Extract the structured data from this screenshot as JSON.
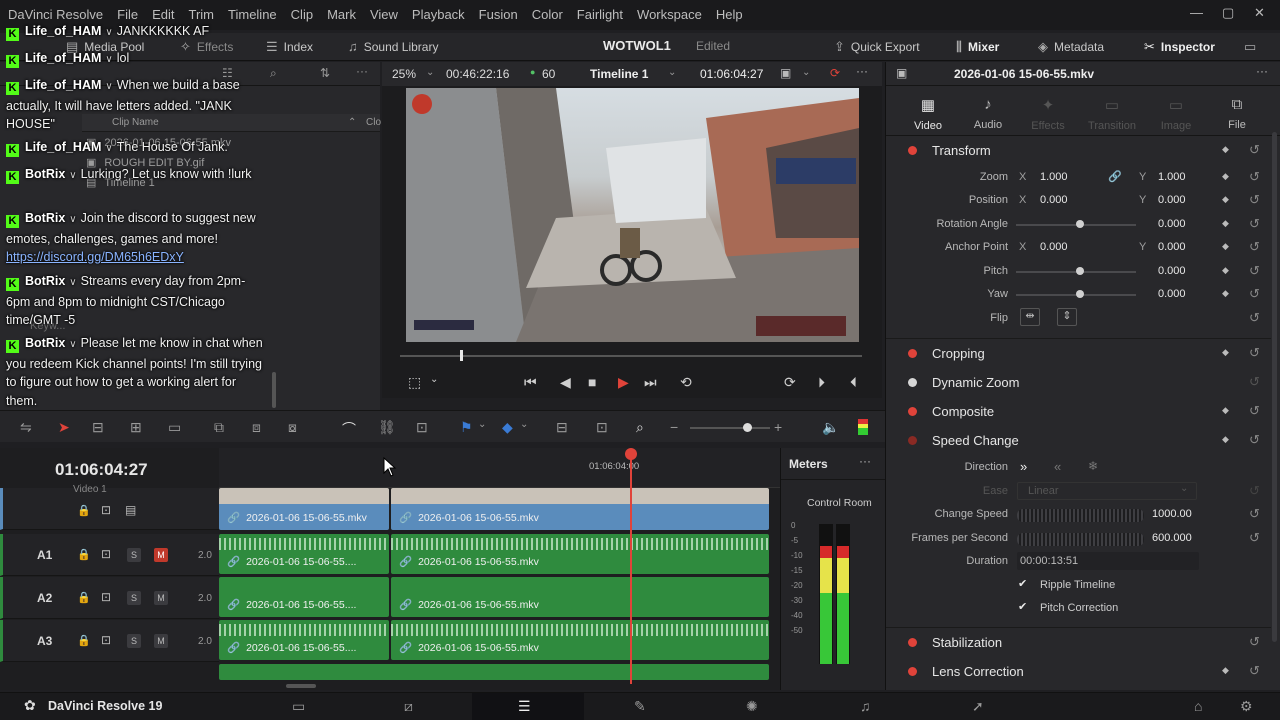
{
  "menubar": [
    "DaVinci Resolve",
    "File",
    "Edit",
    "Trim",
    "Timeline",
    "Clip",
    "Mark",
    "View",
    "Playback",
    "Fusion",
    "Color",
    "Fairlight",
    "Workspace",
    "Help"
  ],
  "toolbar": {
    "media_pool": "Media Pool",
    "effects": "Effects",
    "index": "Index",
    "sound_library": "Sound Library",
    "project_title": "WOTWOL1",
    "project_status": "Edited",
    "quick_export": "Quick Export",
    "mixer": "Mixer",
    "metadata": "Metadata",
    "inspector": "Inspector"
  },
  "media_pool": {
    "column_clip_name": "Clip Name",
    "column_other": "Clo",
    "rows": [
      "2026-01-06 15-06-55.mkv",
      "ROUGH EDIT BY.gif",
      "Timeline 1"
    ],
    "faded_labels": [
      "Keyw..."
    ]
  },
  "chat": [
    {
      "user": "Life_of_HAM",
      "text": "JANKKKKKK AF"
    },
    {
      "user": "Life_of_HAM",
      "text": "lol"
    },
    {
      "user": "Life_of_HAM",
      "text": "When we build a base actually, It will have letters added. \"JANK HOUSE\""
    },
    {
      "user": "Life_of_HAM",
      "text": "The House Of Jank."
    },
    {
      "user": "BotRix",
      "text": "Lurking? Let us know with !lurk"
    },
    {
      "user": "BotRix",
      "text": "Join the discord to suggest new emotes, challenges, games and more!",
      "link": "https://discord.gg/DM65h6EDxY"
    },
    {
      "user": "BotRix",
      "text": "Streams every day from 2pm-6pm and 8pm to midnight CST/Chicago time/GMT -5"
    },
    {
      "user": "BotRix",
      "text": "Please let me know in chat when you redeem Kick channel points! I'm still trying to figure out how to get a working alert for them."
    }
  ],
  "viewer": {
    "zoom": "25%",
    "source_tc": "00:46:22:16",
    "fps": "60",
    "timeline_name": "Timeline 1",
    "record_tc": "01:06:04:27",
    "clip_name": "2026-01-06 15-06-55.mkv",
    "playhead_fraction": 0.13
  },
  "timeline": {
    "timecode": "01:06:04:27",
    "ruler_mark": "01:06:04:00",
    "video_track": {
      "name": "Video 1",
      "clips": [
        "2026-01-06 15-06-55.mkv",
        "2026-01-06 15-06-55.mkv"
      ]
    },
    "audio_tracks": [
      {
        "name": "A1",
        "vol": "2.0",
        "mute": true,
        "clips": [
          "2026-01-06 15-06-55....",
          "2026-01-06 15-06-55.mkv"
        ]
      },
      {
        "name": "A2",
        "vol": "2.0",
        "mute": false,
        "clips": [
          "2026-01-06 15-06-55....",
          "2026-01-06 15-06-55.mkv"
        ]
      },
      {
        "name": "A3",
        "vol": "2.0",
        "mute": false,
        "clips": [
          "2026-01-06 15-06-55....",
          "2026-01-06 15-06-55.mkv"
        ]
      }
    ],
    "solo_label": "S",
    "mute_label": "M"
  },
  "meters": {
    "title": "Meters",
    "control_room": "Control Room",
    "scale": [
      "0",
      "-5",
      "-10",
      "-15",
      "-20",
      "-30",
      "-40",
      "-50"
    ]
  },
  "inspector": {
    "clip_name": "2026-01-06 15-06-55.mkv",
    "tabs": [
      {
        "label": "Video",
        "icon": "film-icon",
        "state": "active"
      },
      {
        "label": "Audio",
        "icon": "music-note-icon",
        "state": "enabled"
      },
      {
        "label": "Effects",
        "icon": "wand-icon",
        "state": "disabled"
      },
      {
        "label": "Transition",
        "icon": "transition-icon",
        "state": "disabled"
      },
      {
        "label": "Image",
        "icon": "image-icon",
        "state": "disabled"
      },
      {
        "label": "File",
        "icon": "file-icon",
        "state": "enabled"
      }
    ],
    "transform": {
      "title": "Transform",
      "zoom": {
        "label": "Zoom",
        "x": "1.000",
        "y": "1.000"
      },
      "position": {
        "label": "Position",
        "x": "0.000",
        "y": "0.000"
      },
      "rotation": {
        "label": "Rotation Angle",
        "value": "0.000"
      },
      "anchor": {
        "label": "Anchor Point",
        "x": "0.000",
        "y": "0.000"
      },
      "pitch": {
        "label": "Pitch",
        "value": "0.000"
      },
      "yaw": {
        "label": "Yaw",
        "value": "0.000"
      },
      "flip": {
        "label": "Flip"
      }
    },
    "sections": {
      "cropping": "Cropping",
      "dynamic_zoom": "Dynamic Zoom",
      "composite": "Composite",
      "speed_change": "Speed Change",
      "stabilization": "Stabilization",
      "lens_correction": "Lens Correction"
    },
    "speed": {
      "direction_label": "Direction",
      "ease_label": "Ease",
      "ease_value": "Linear",
      "change_speed_label": "Change Speed",
      "change_speed_value": "1000.00",
      "fps_label": "Frames per Second",
      "fps_value": "600.000",
      "duration_label": "Duration",
      "duration_value": "00:00:13:51",
      "ripple": "Ripple Timeline",
      "pitch_correction": "Pitch Correction"
    },
    "axis_x": "X",
    "axis_y": "Y"
  },
  "app_name": "DaVinci Resolve 19",
  "colors": {
    "accent_red": "#e0433a",
    "kick_green": "#53fc18",
    "video_clip": "#5a8cbc",
    "audio_clip": "#2f8b3e"
  }
}
